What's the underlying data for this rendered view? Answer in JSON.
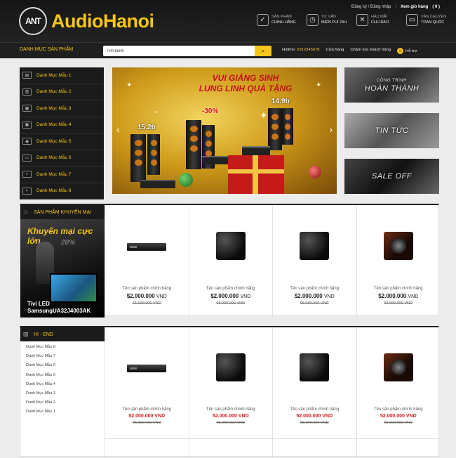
{
  "header": {
    "logo_mark": "ANT",
    "logo_text": "AudioHanoi",
    "top_links": {
      "login": "Đăng ký / Đăng nhập",
      "cart": "Xem giỏ hàng",
      "cart_count": "( 0 )"
    },
    "features": [
      {
        "icon": "shield-check-icon",
        "line1": "SẢN PHẨM",
        "line2": "CHÍNH HÃNG"
      },
      {
        "icon": "clock-icon",
        "line1": "TƯ VẤN",
        "line2": "MIỄN PHÍ 24H"
      },
      {
        "icon": "tools-icon",
        "line1": "HẬU MÃI",
        "line2": "CHU ĐÁO"
      },
      {
        "icon": "truck-icon",
        "line1": "VẬN CHUYỂN",
        "line2": "TOÀN QUỐC"
      }
    ]
  },
  "nav": {
    "category_title": "DANH MỤC SẢN PHẨM",
    "search_value": "Tìm kiếm",
    "hotline_label": "Hotline:",
    "hotline_number": "0912345678",
    "links": [
      "Cửa hàng",
      "Chăm sóc khách hàng"
    ],
    "support": "Hỗ trợ"
  },
  "side_categories": [
    "Danh Mục Mẫu 1",
    "Danh Mục Mẫu 2",
    "Danh Mục Mẫu 3",
    "Danh Mục Mẫu 4",
    "Danh Mục Mẫu 5",
    "Danh Mục Mẫu 6",
    "Danh Mục Mẫu 7",
    "Danh Mục Mẫu 8"
  ],
  "banner": {
    "title1": "VUI GIÁNG SINH",
    "title2": "LUNG LINH QUÀ TẶNG",
    "price1": "15.2tr",
    "price2": "-30%",
    "price3": "14.9tr",
    "prev": "‹",
    "next": "›"
  },
  "promos": [
    {
      "sub": "CÔNG TRÌNH",
      "label": "HOÀN THÀNH"
    },
    {
      "sub": "",
      "label": "TIN TỨC"
    },
    {
      "sub": "",
      "label": "SALE OFF"
    }
  ],
  "section_promo": {
    "title": "SẢN PHẨM KHUYẾN MẠI",
    "box_title": "Khuyến mại cực lớn",
    "box_percent": "20%",
    "box_product_line1": "Tivi LED",
    "box_product_line2": "SamsungUA32J4003AK",
    "products": [
      {
        "name": "Tên sản phẩm chính hãng",
        "price": "$2.000.000",
        "currency": "VND",
        "old": "65.000.000 VND",
        "kind": "amp"
      },
      {
        "name": "Tên sản phẩm chính hãng",
        "price": "$2.000.000",
        "currency": "VND",
        "old": "65.000.000 VND",
        "kind": "sub"
      },
      {
        "name": "Tên sản phẩm chính hãng",
        "price": "$2.000.000",
        "currency": "VND",
        "old": "65.000.000 VND",
        "kind": "sub"
      },
      {
        "name": "Tên sản phẩm chính hãng",
        "price": "$2.000.000",
        "currency": "VND",
        "old": "65.000.000 VND",
        "kind": "sub-b"
      }
    ]
  },
  "section_hiend": {
    "title": "HI - END",
    "sub_items": [
      "Danh Mục Mẫu 8",
      "Danh Mục Mẫu 7",
      "Danh Mục Mẫu 6",
      "Danh Mục Mẫu 5",
      "Danh Mục Mẫu 4",
      "Danh Mục Mẫu 3",
      "Danh Mục Mẫu 2",
      "Danh Mục Mẫu 1"
    ],
    "products": [
      {
        "name": "Tên sản phẩm chính hãng",
        "price": "52.000.000 VND",
        "old": "65.000.000 VND",
        "kind": "amp"
      },
      {
        "name": "Tên sản phẩm chính hãng",
        "price": "52.000.000 VND",
        "old": "65.000.000 VND",
        "kind": "sub"
      },
      {
        "name": "Tên sản phẩm chính hãng",
        "price": "52.000.000 VND",
        "old": "65.000.000 VND",
        "kind": "sub"
      },
      {
        "name": "Tên sản phẩm chính hãng",
        "price": "52.000.000 VND",
        "old": "65.000.000 VND",
        "kind": "sub-b"
      }
    ]
  },
  "colors": {
    "accent": "#f5c518",
    "header_bg": "#1a1a1a",
    "sale_red": "#d61d1d"
  }
}
